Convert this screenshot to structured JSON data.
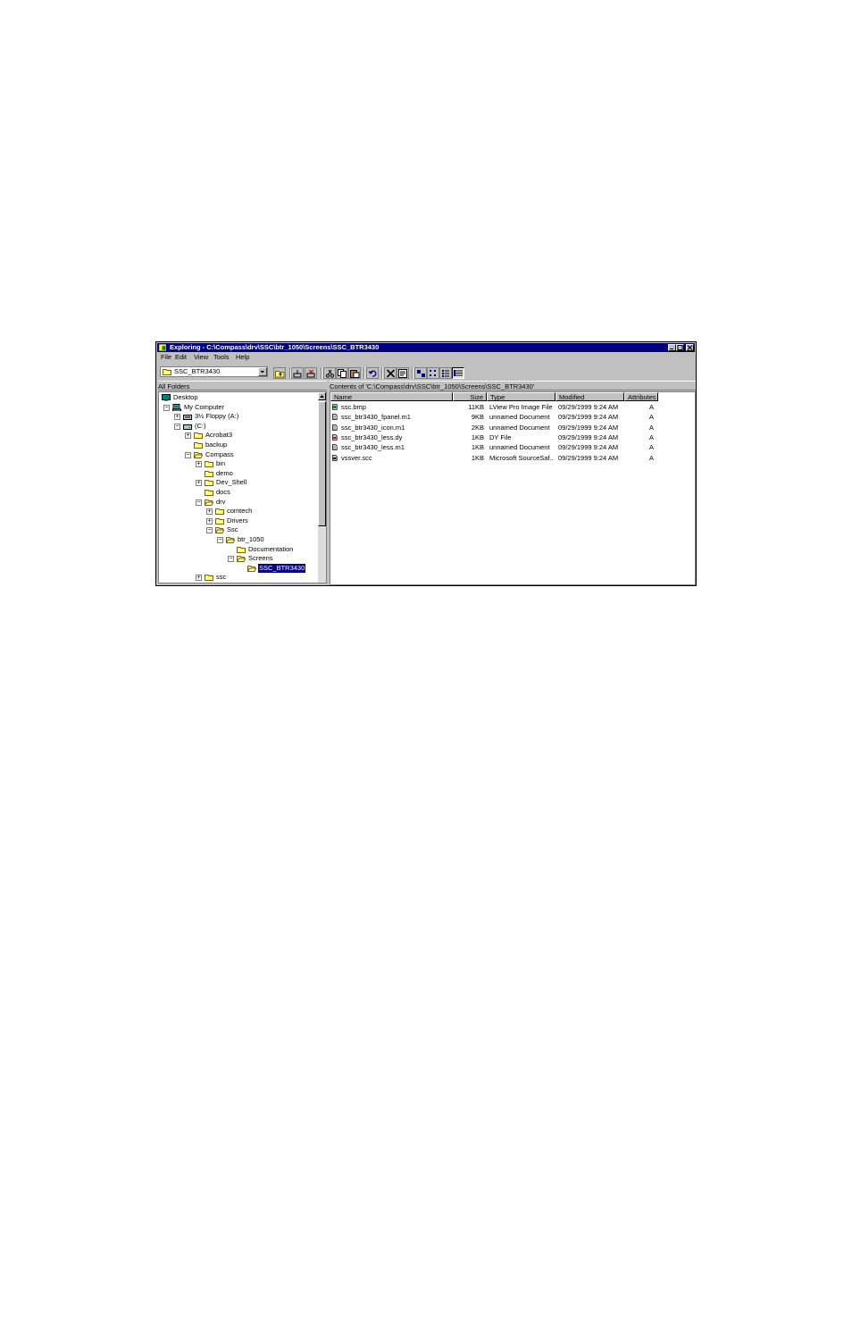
{
  "window": {
    "title": "Exploring - C:\\Compass\\drv\\SSC\\btr_1050\\Screens\\SSC_BTR3430"
  },
  "menu": [
    "File",
    "Edit",
    "View",
    "Tools",
    "Help"
  ],
  "address": {
    "value": "SSC_BTR3430"
  },
  "toolbar_icons": [
    "up-folder-icon",
    "map-drive-icon",
    "disconnect-icon",
    "cut-icon",
    "copy-icon",
    "paste-icon",
    "undo-icon",
    "delete-icon",
    "properties-icon",
    "large-icons-icon",
    "small-icons-icon",
    "list-view-icon",
    "details-view-icon"
  ],
  "panes": {
    "left_header": "All Folders",
    "right_header": "Contents of 'C:\\Compass\\drv\\SSC\\btr_1050\\Screens\\SSC_BTR3430'"
  },
  "tree": [
    {
      "label": "Desktop",
      "level": 0,
      "toggle": "",
      "icon": "desktop-icon"
    },
    {
      "label": "My Computer",
      "level": 1,
      "toggle": "-",
      "icon": "computer-icon"
    },
    {
      "label": "3½ Floppy (A:)",
      "level": 2,
      "toggle": "+",
      "icon": "floppy-icon"
    },
    {
      "label": "(C:)",
      "level": 2,
      "toggle": "-",
      "icon": "drive-icon"
    },
    {
      "label": "Acrobat3",
      "level": 3,
      "toggle": "+",
      "icon": "folder-icon"
    },
    {
      "label": "backup",
      "level": 3,
      "toggle": "",
      "icon": "folder-icon"
    },
    {
      "label": "Compass",
      "level": 3,
      "toggle": "-",
      "icon": "open-folder-icon"
    },
    {
      "label": "bin",
      "level": 4,
      "toggle": "+",
      "icon": "folder-icon"
    },
    {
      "label": "demo",
      "level": 4,
      "toggle": "",
      "icon": "folder-icon"
    },
    {
      "label": "Dev_Shell",
      "level": 4,
      "toggle": "+",
      "icon": "folder-icon"
    },
    {
      "label": "docs",
      "level": 4,
      "toggle": "",
      "icon": "folder-icon"
    },
    {
      "label": "drv",
      "level": 4,
      "toggle": "-",
      "icon": "open-folder-icon"
    },
    {
      "label": "comtech",
      "level": 5,
      "toggle": "+",
      "icon": "folder-icon"
    },
    {
      "label": "Drivers",
      "level": 5,
      "toggle": "+",
      "icon": "folder-icon"
    },
    {
      "label": "Ssc",
      "level": 5,
      "toggle": "-",
      "icon": "open-folder-icon"
    },
    {
      "label": "btr_1050",
      "level": 6,
      "toggle": "-",
      "icon": "open-folder-icon"
    },
    {
      "label": "Documentation",
      "level": 7,
      "toggle": "",
      "icon": "folder-icon"
    },
    {
      "label": "Screens",
      "level": 7,
      "toggle": "-",
      "icon": "open-folder-icon"
    },
    {
      "label": "SSC_BTR3430",
      "level": 8,
      "toggle": "",
      "icon": "open-folder-icon",
      "selected": true
    },
    {
      "label": "ssc",
      "level": 4,
      "toggle": "+",
      "icon": "folder-icon"
    }
  ],
  "columns": [
    "Name",
    "Size",
    "Type",
    "Modified",
    "Attributes"
  ],
  "files": [
    {
      "name": "ssc.bmp",
      "size": "11KB",
      "type": "LView Pro Image File",
      "modified": "09/29/1999 9:24 AM",
      "attr": "A",
      "icon": "image-file-icon"
    },
    {
      "name": "ssc_btr3430_fpanel.m1",
      "size": "9KB",
      "type": "unnamed Document",
      "modified": "09/29/1999 9:24 AM",
      "attr": "A",
      "icon": "document-icon"
    },
    {
      "name": "ssc_btr3430_icon.m1",
      "size": "2KB",
      "type": "unnamed Document",
      "modified": "09/29/1999 9:24 AM",
      "attr": "A",
      "icon": "document-icon"
    },
    {
      "name": "ssc_btr3430_less.dy",
      "size": "1KB",
      "type": "DY File",
      "modified": "09/29/1999 9:24 AM",
      "attr": "A",
      "icon": "dy-file-icon"
    },
    {
      "name": "ssc_btr3430_less.m1",
      "size": "1KB",
      "type": "unnamed Document",
      "modified": "09/29/1999 9:24 AM",
      "attr": "A",
      "icon": "document-icon"
    },
    {
      "name": "vssver.scc",
      "size": "1KB",
      "type": "Microsoft SourceSaf...",
      "modified": "09/29/1999 9:24 AM",
      "attr": "A",
      "icon": "sourcesafe-file-icon"
    }
  ],
  "colors": {
    "title_bar": "#000080",
    "face": "#c0c0c0",
    "selection": "#000080"
  }
}
